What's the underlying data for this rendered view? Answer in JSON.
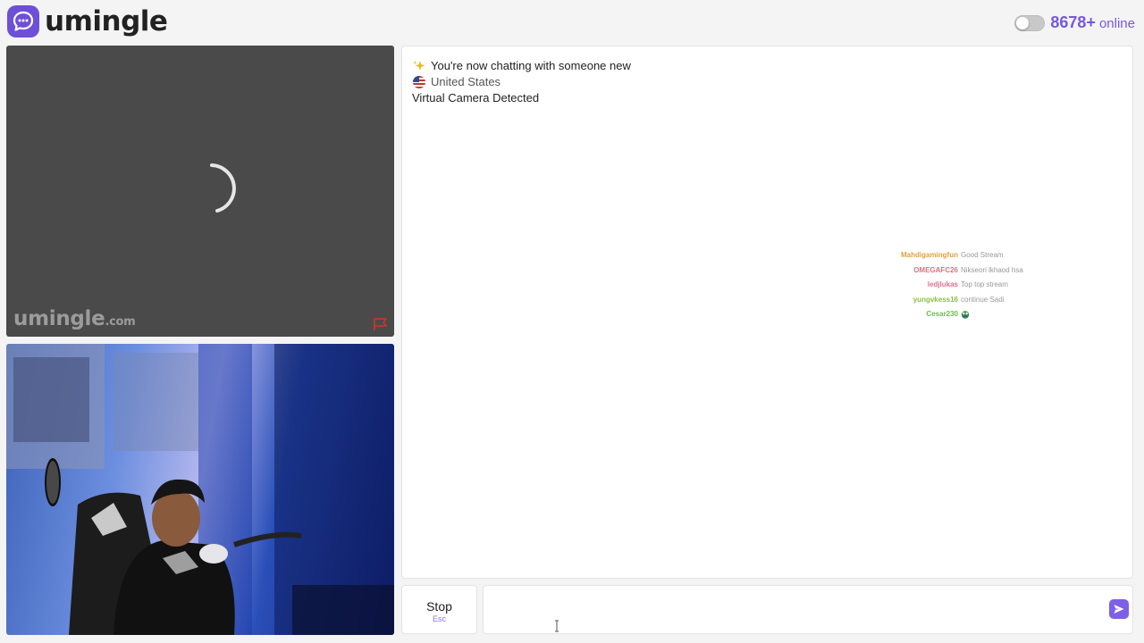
{
  "header": {
    "brand": "umingle",
    "online_count": "8678+",
    "online_label": "online"
  },
  "stranger_video": {
    "watermark_brand": "umingle",
    "watermark_suffix": ".com"
  },
  "chat": {
    "system_messages": [
      {
        "icon": "sparkles-icon",
        "text": "You're now chatting with someone new"
      },
      {
        "icon": "us-flag-icon",
        "text": "United States"
      },
      {
        "icon": "",
        "text": "Virtual Camera Detected"
      }
    ],
    "stream_overlay": [
      {
        "user": "Mahdigamingfun",
        "message": "Good Stream",
        "user_color": "#e0a040"
      },
      {
        "user": "OMEGAFC26",
        "message": "Nikseori lkhaod hsa",
        "user_color": "#e07080"
      },
      {
        "user": "ledjlukas",
        "message": "Top top stream",
        "user_color": "#e07090"
      },
      {
        "user": "yungvkess16",
        "message": "continue Sadi",
        "user_color": "#8ac040"
      },
      {
        "user": "Cesar230",
        "message": "",
        "user_color": "#6ac040"
      }
    ]
  },
  "controls": {
    "stop_label": "Stop",
    "stop_hint": "Esc",
    "message_placeholder": ""
  },
  "colors": {
    "accent": "#7658e0",
    "brand_icon": "#6d4fd8",
    "report": "#c0392b"
  }
}
